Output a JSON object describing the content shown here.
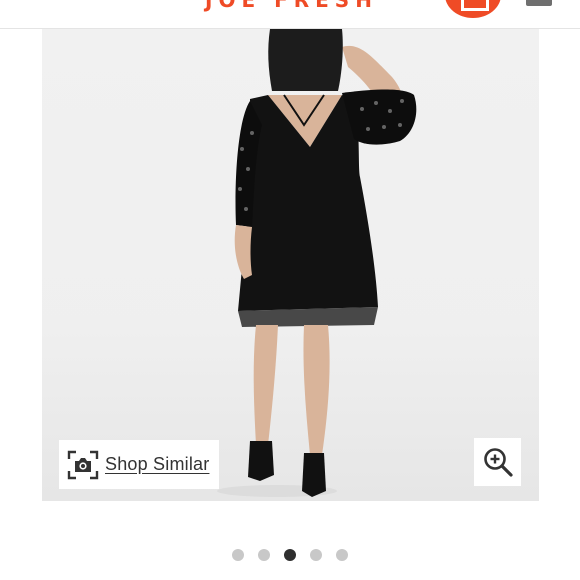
{
  "header": {
    "brand_text": "JOE FRESH",
    "scan_icon": "barcode-scan-icon",
    "menu_icon": "menu-icon",
    "accent_color": "#ef4b26"
  },
  "product_image": {
    "alt": "Black sequin-sleeve babydoll dress, back view"
  },
  "shop_similar": {
    "label": "Shop Similar",
    "icon": "camera-icon"
  },
  "zoom": {
    "icon": "zoom-in-icon"
  },
  "carousel": {
    "count": 5,
    "active_index": 3
  }
}
